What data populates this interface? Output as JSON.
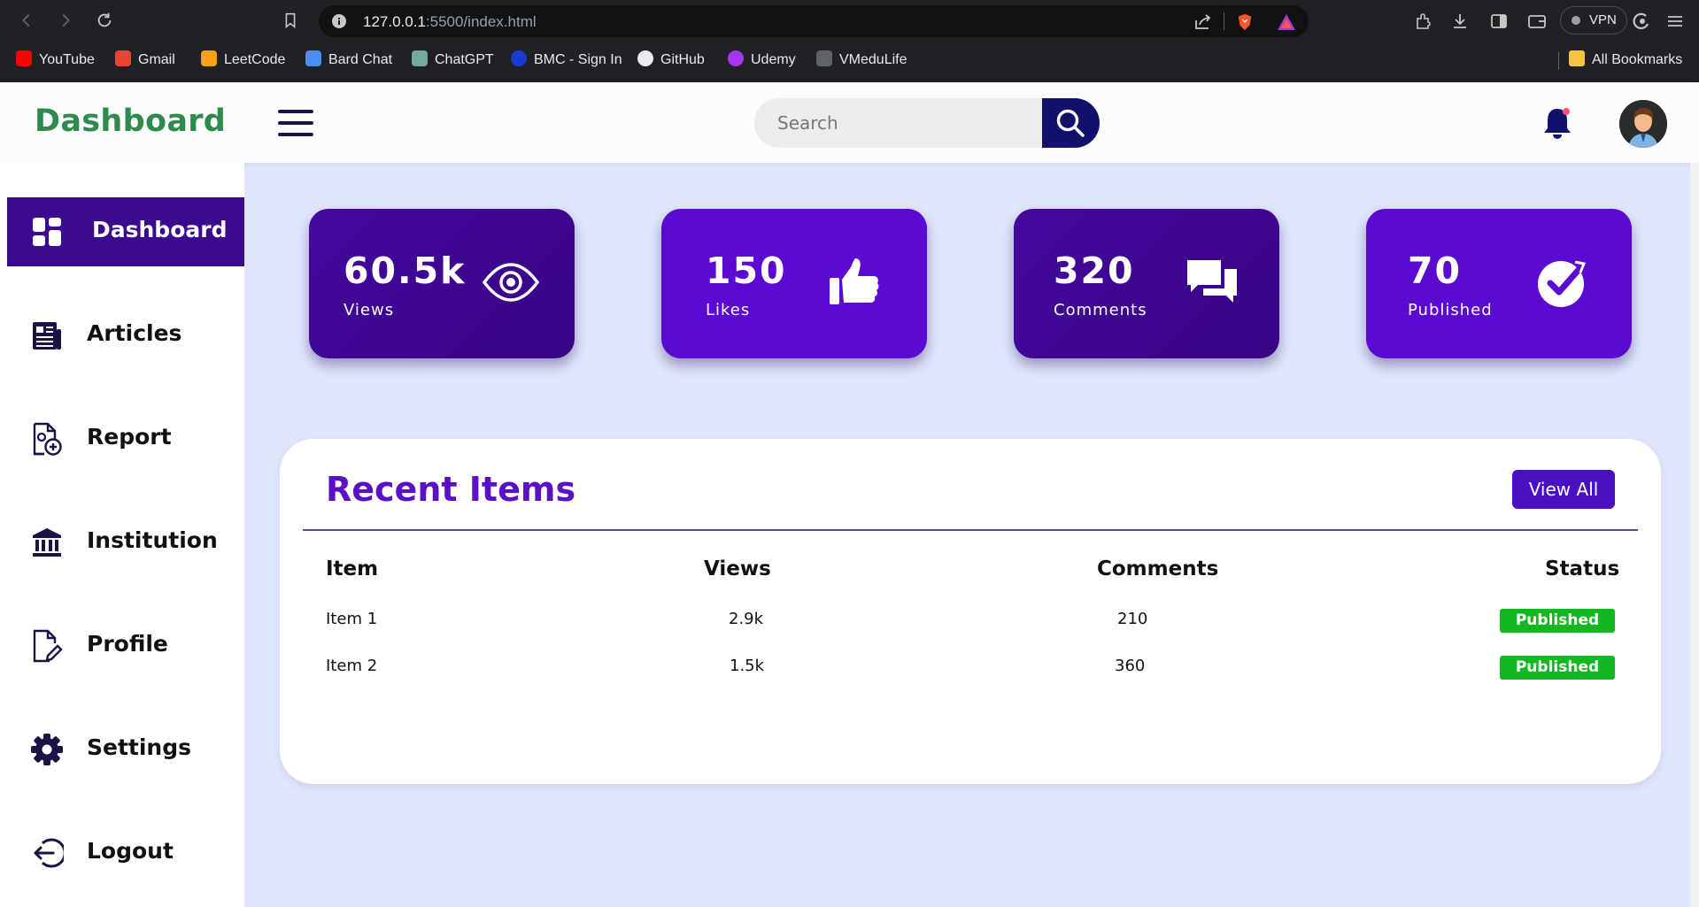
{
  "browser": {
    "url_host": "127.0.0.1",
    "url_rest": ":5500/index.html",
    "vpn_label": "VPN",
    "bookmarks": [
      {
        "label": "YouTube",
        "color": "#ff0000"
      },
      {
        "label": "Gmail",
        "color": "#ea4335"
      },
      {
        "label": "LeetCode",
        "color": "#ffa116"
      },
      {
        "label": "Bard Chat",
        "color": "#4c8df6"
      },
      {
        "label": "ChatGPT",
        "color": "#74aa9c"
      },
      {
        "label": "BMC - Sign In",
        "color": "#1a3bd0"
      },
      {
        "label": "GitHub",
        "color": "#e8eaed"
      },
      {
        "label": "Udemy",
        "color": "#a435f0"
      },
      {
        "label": "VMeduLife",
        "color": "#9aa0a6"
      }
    ],
    "all_bookmarks": "All Bookmarks"
  },
  "header": {
    "logo": "Dashboard",
    "search_placeholder": "Search",
    "notification_dot_color": "#ff4f7b"
  },
  "sidebar": {
    "items": [
      {
        "label": "Dashboard",
        "icon": "grid-icon",
        "active": true
      },
      {
        "label": "Articles",
        "icon": "newspaper-icon",
        "active": false
      },
      {
        "label": "Report",
        "icon": "file-plus-icon",
        "active": false
      },
      {
        "label": "Institution",
        "icon": "bank-icon",
        "active": false
      },
      {
        "label": "Profile",
        "icon": "file-edit-icon",
        "active": false
      },
      {
        "label": "Settings",
        "icon": "gear-icon",
        "active": false
      },
      {
        "label": "Logout",
        "icon": "logout-icon",
        "active": false
      }
    ]
  },
  "stats": [
    {
      "value": "60.5k",
      "label": "Views",
      "icon": "eye-icon",
      "color": "#3c0a8f"
    },
    {
      "value": "150",
      "label": "Likes",
      "icon": "thumbs-up-icon",
      "color": "#5a0ad1"
    },
    {
      "value": "320",
      "label": "Comments",
      "icon": "comments-icon",
      "color": "#3c0a8f"
    },
    {
      "value": "70",
      "label": "Published",
      "icon": "check-circle-icon",
      "color": "#5a0ad1"
    }
  ],
  "recent": {
    "title": "Recent Items",
    "view_all": "View All",
    "columns": [
      "Item",
      "Views",
      "Comments",
      "Status"
    ],
    "rows": [
      {
        "item": "Item 1",
        "views": "2.9k",
        "comments": "210",
        "status": "Published"
      },
      {
        "item": "Item 2",
        "views": "1.5k",
        "comments": "360",
        "status": "Published"
      }
    ]
  }
}
